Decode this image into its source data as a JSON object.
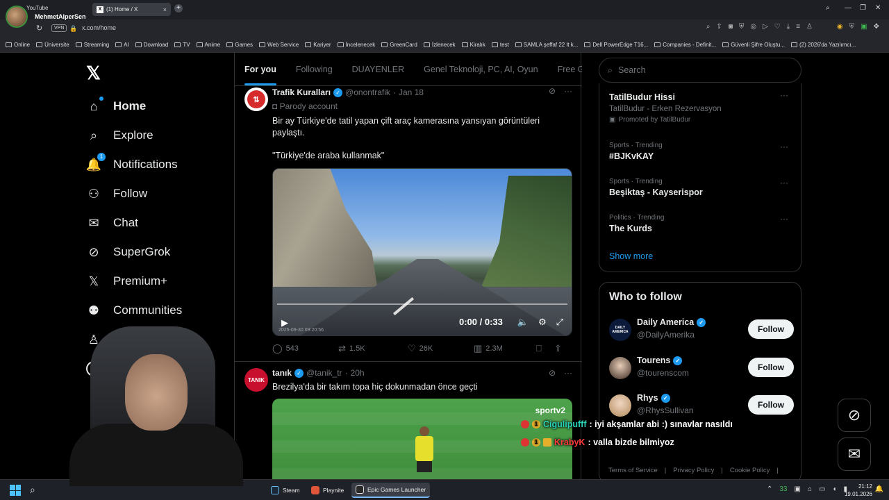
{
  "browser": {
    "profile": {
      "top_label": "YouTube",
      "name": "MehmetAlperSen"
    },
    "tab": {
      "title": "(1) Home / X"
    },
    "vpn_label": "VPN",
    "url": "x.com/home",
    "bookmarks": [
      "Online",
      "Üniversite",
      "Streaming",
      "AI",
      "Download",
      "TV",
      "Anime",
      "Games",
      "Web Service",
      "Kariyer",
      "İncelenecek",
      "GreenCard",
      "İzlenecek",
      "Kiralık",
      "test",
      "SAMLA şeffaf 22 lt k...",
      "Dell PowerEdge T16...",
      "Companies - Definit...",
      "Güvenli Şifre Oluştu...",
      "(2) 2026'da Yazılımcı..."
    ]
  },
  "sidebar": {
    "items": [
      {
        "label": "Home",
        "icon": "home-icon"
      },
      {
        "label": "Explore",
        "icon": "search-icon"
      },
      {
        "label": "Notifications",
        "icon": "bell-icon",
        "badge": "1"
      },
      {
        "label": "Follow",
        "icon": "person-plus-icon"
      },
      {
        "label": "Chat",
        "icon": "mail-icon"
      },
      {
        "label": "SuperGrok",
        "icon": "grok-icon"
      },
      {
        "label": "Premium+",
        "icon": "x-icon"
      },
      {
        "label": "Communities",
        "icon": "people-icon"
      },
      {
        "label": "Pr",
        "icon": "profile-icon"
      },
      {
        "label": "",
        "icon": "more-icon"
      }
    ]
  },
  "feed": {
    "tabs": [
      "For you",
      "Following",
      "DUAYENLER",
      "Genel Teknoloji, PC, AI, Oyun",
      "Free G"
    ],
    "tweets": [
      {
        "name": "Trafik Kuralları",
        "handle": "@onontrafik",
        "time": "Jan 18",
        "parody": "Parody account",
        "text1": "Bir ay Türkiye'de tatil yapan çift araç kamerasına yansıyan görüntüleri paylaştı.",
        "text2": "\"Türkiye'de araba kullanmak\"",
        "video_time": "0:00 / 0:33",
        "video_stamp": "2025-09-30 09:20:56",
        "replies": "543",
        "reposts": "1.5K",
        "likes": "26K",
        "views": "2.3M"
      },
      {
        "name": "tanık",
        "handle": "@tanik_tr",
        "time": "20h",
        "avatar_text": "TANIK",
        "text1": "Brezilya'da bir takım topa hiç dokunmadan önce geçti",
        "media_logo": "sportv2"
      }
    ]
  },
  "search": {
    "placeholder": "Search"
  },
  "trends": [
    {
      "title": "TatilBudur Hissi",
      "sub": "TatilBudur - Erken Rezervasyon",
      "promo": "Promoted by TatilBudur"
    },
    {
      "meta": "Sports · Trending",
      "title": "#BJKvKAY"
    },
    {
      "meta": "Sports · Trending",
      "title": "Beşiktaş - Kayserispor"
    },
    {
      "meta": "Politics · Trending",
      "title": "The Kurds"
    }
  ],
  "show_more": "Show more",
  "who_to_follow": {
    "title": "Who to follow",
    "people": [
      {
        "name": "Daily America",
        "handle": "@DailyAmerika",
        "button": "Follow",
        "avatar_text": "DAILY AMERICA"
      },
      {
        "name": "Tourens",
        "handle": "@tourenscom",
        "button": "Follow"
      },
      {
        "name": "Rhys",
        "handle": "@RhysSullivan",
        "button": "Follow"
      }
    ]
  },
  "footer": [
    "Terms of Service",
    "|",
    "Privacy Policy",
    "|",
    "Cookie Policy",
    "|"
  ],
  "chat_overlay": [
    {
      "user": "Cigulipufff",
      "message": ": iyi akşamlar abi :) sınavlar nasıldı",
      "badge": "1"
    },
    {
      "user": "KrabyK",
      "message": ": valla bizde bilmiyoz",
      "badge": "1"
    }
  ],
  "taskbar": {
    "apps": [
      "Steam",
      "Playnite",
      "Epic Games Launcher"
    ],
    "tray_number": "33",
    "time": "21:12",
    "date": "19.01.2026"
  },
  "colors": {
    "accent": "#1d9bf0",
    "background": "#000000",
    "text": "#e7e9ea",
    "muted": "#71767b"
  }
}
